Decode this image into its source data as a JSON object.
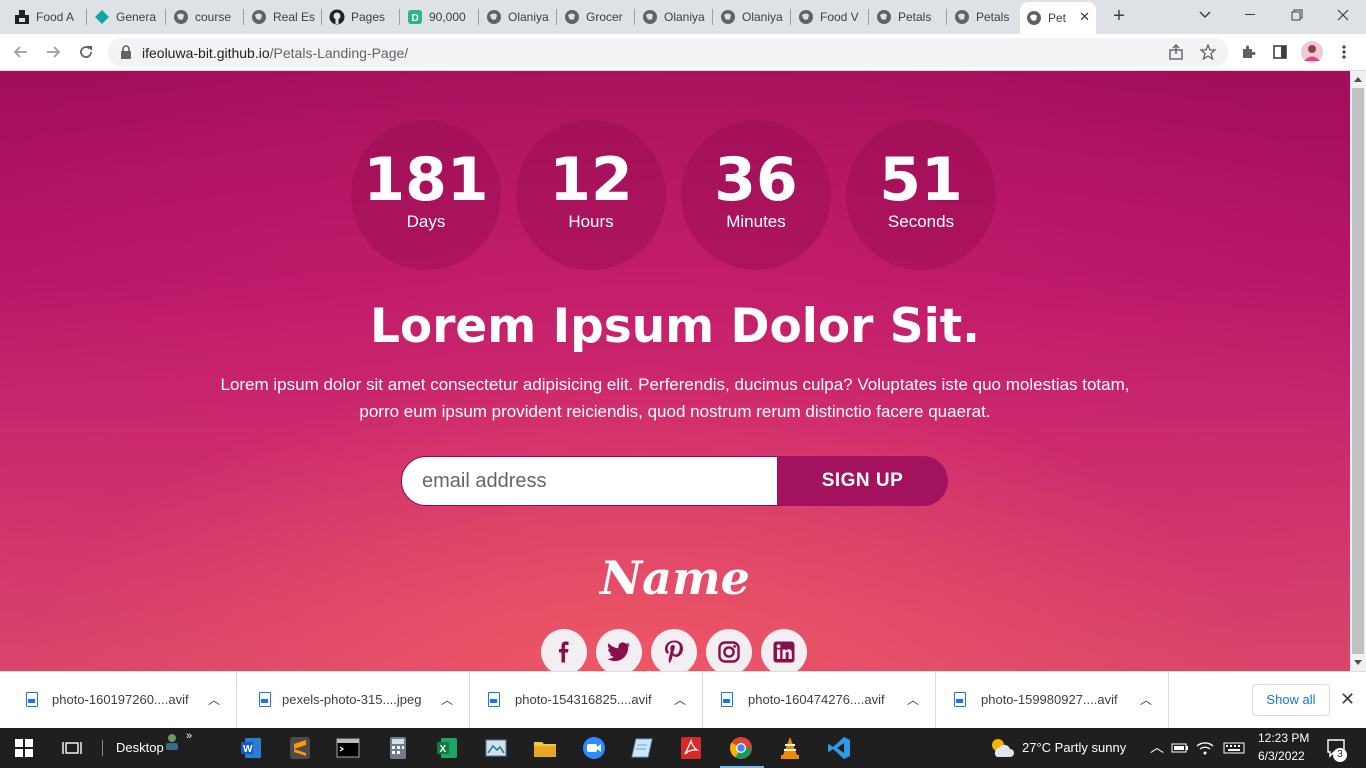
{
  "browser": {
    "tabs": [
      {
        "title": "Food A",
        "icon": "black-square-icon"
      },
      {
        "title": "Genera",
        "icon": "teal-diamond-icon"
      },
      {
        "title": "course",
        "icon": "globe-icon"
      },
      {
        "title": "Real Es",
        "icon": "globe-icon"
      },
      {
        "title": "Pages",
        "icon": "github-icon"
      },
      {
        "title": "90,000",
        "icon": "d-badge-icon"
      },
      {
        "title": "Olaniya",
        "icon": "globe-icon"
      },
      {
        "title": "Grocer",
        "icon": "globe-icon"
      },
      {
        "title": "Olaniya",
        "icon": "globe-icon"
      },
      {
        "title": "Olaniya",
        "icon": "globe-icon"
      },
      {
        "title": "Food V",
        "icon": "globe-icon"
      },
      {
        "title": "Petals",
        "icon": "globe-icon"
      },
      {
        "title": "Petals",
        "icon": "globe-icon"
      },
      {
        "title": "Pet",
        "icon": "globe-icon",
        "active": true
      }
    ],
    "address": {
      "host": "ifeoluwa-bit.github.io",
      "path": "/Petals-Landing-Page/"
    }
  },
  "page": {
    "countdown": [
      {
        "value": "181",
        "label": "Days"
      },
      {
        "value": "12",
        "label": "Hours"
      },
      {
        "value": "36",
        "label": "Minutes"
      },
      {
        "value": "51",
        "label": "Seconds"
      }
    ],
    "headline": "Lorem Ipsum Dolor Sit.",
    "lead": "Lorem ipsum dolor sit amet consectetur adipisicing elit. Perferendis, ducimus culpa? Voluptates iste quo molestias totam, porro eum ipsum provident reiciendis, quod nostrum rerum distinctio facere quaerat.",
    "email_placeholder": "email address",
    "signup_label": "SIGN UP",
    "brand": "Name",
    "socials": [
      "facebook-icon",
      "twitter-icon",
      "pinterest-icon",
      "instagram-icon",
      "linkedin-icon"
    ],
    "colors": {
      "accent": "#a3125e",
      "bg_top": "#a10e5a",
      "bg_bottom": "#d9466b"
    }
  },
  "downloads": {
    "items": [
      "photo-160197260....avif",
      "pexels-photo-315....jpeg",
      "photo-154316825....avif",
      "photo-160474276....avif",
      "photo-159980927....avif"
    ],
    "show_all": "Show all"
  },
  "taskbar": {
    "desktop_label": "Desktop",
    "weather": "27°C  Partly sunny",
    "time": "12:23 PM",
    "date": "6/3/2022",
    "notifications": "3"
  }
}
